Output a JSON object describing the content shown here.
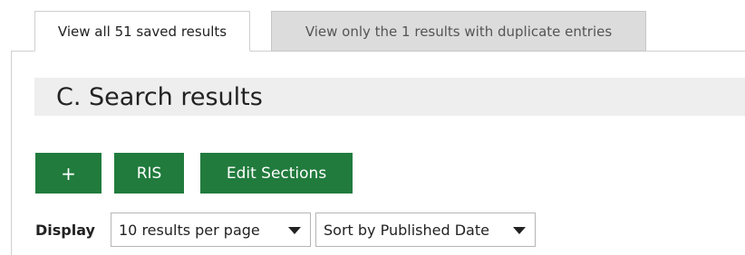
{
  "tabs": [
    {
      "label": "View all 51 saved results",
      "active": true
    },
    {
      "label": "View only the 1 results with duplicate entries",
      "active": false
    }
  ],
  "section": {
    "title": "C. Search results"
  },
  "toolbar": {
    "add_label": "+",
    "ris_label": "RIS",
    "edit_sections_label": "Edit Sections"
  },
  "display": {
    "label": "Display",
    "per_page_selected": "10 results per page",
    "sort_selected": "Sort by Published Date"
  },
  "colors": {
    "button_green": "#217b3d",
    "title_bar_bg": "#eeeeee",
    "inactive_tab_bg": "#dcdcdc"
  },
  "icons": {
    "per_page_dropdown": "caret-down-icon",
    "sort_dropdown": "caret-down-icon"
  }
}
